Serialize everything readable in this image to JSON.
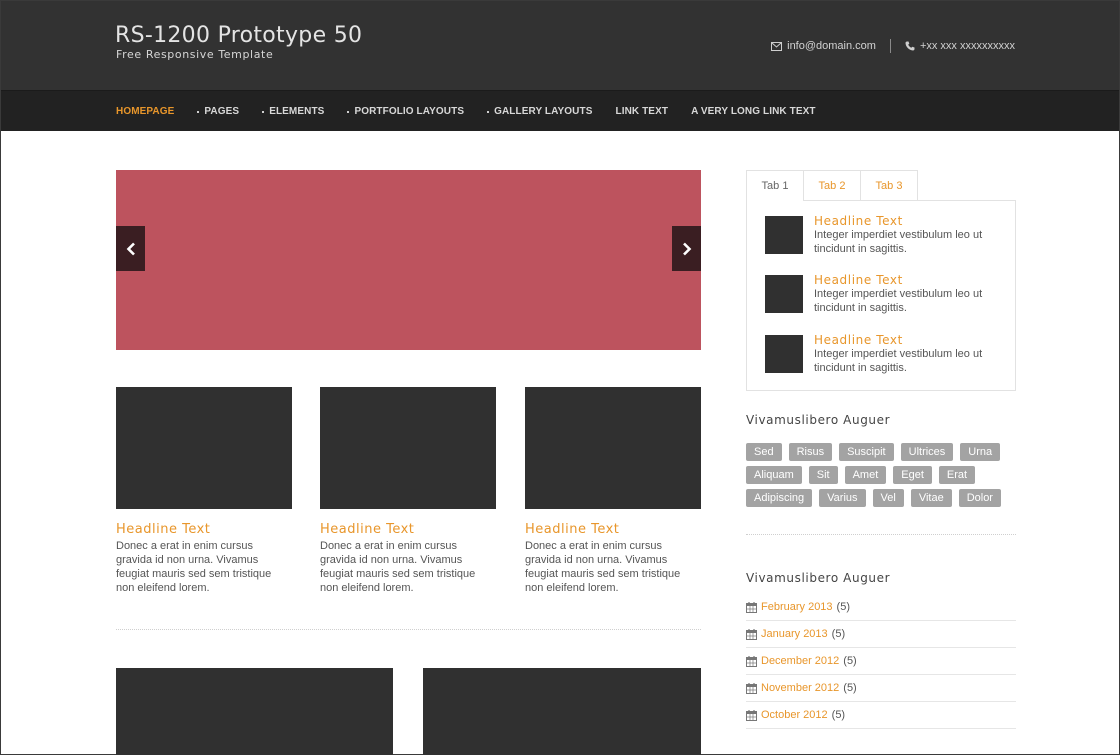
{
  "header": {
    "title": "RS-1200 Prototype 50",
    "tagline": "Free Responsive Template",
    "email": "info@domain.com",
    "phone": "+xx xxx xxxxxxxxxx"
  },
  "nav": {
    "items": [
      {
        "label": "HOMEPAGE"
      },
      {
        "label": "PAGES"
      },
      {
        "label": "ELEMENTS"
      },
      {
        "label": "PORTFOLIO LAYOUTS"
      },
      {
        "label": "GALLERY LAYOUTS"
      },
      {
        "label": "LINK TEXT"
      },
      {
        "label": "A VERY LONG LINK TEXT"
      }
    ]
  },
  "features": [
    {
      "title": "Headline Text",
      "text": "Donec a erat in enim cursus gravida id non urna. Vivamus feugiat mauris sed sem tristique non eleifend lorem."
    },
    {
      "title": "Headline Text",
      "text": "Donec a erat in enim cursus gravida id non urna. Vivamus feugiat mauris sed sem tristique non eleifend lorem."
    },
    {
      "title": "Headline Text",
      "text": "Donec a erat in enim cursus gravida id non urna. Vivamus feugiat mauris sed sem tristique non eleifend lorem."
    }
  ],
  "tabs": {
    "labels": [
      "Tab 1",
      "Tab 2",
      "Tab 3"
    ],
    "items": [
      {
        "title": "Headline Text",
        "text": "Integer imperdiet vestibulum leo ut tincidunt in sagittis."
      },
      {
        "title": "Headline Text",
        "text": "Integer imperdiet vestibulum leo ut tincidunt in sagittis."
      },
      {
        "title": "Headline Text",
        "text": "Integer imperdiet vestibulum leo ut tincidunt in sagittis."
      }
    ]
  },
  "tags_widget": {
    "title": "Vivamuslibero Auguer",
    "tags": [
      "Sed",
      "Risus",
      "Suscipit",
      "Ultrices",
      "Urna",
      "Aliquam",
      "Sit",
      "Amet",
      "Eget",
      "Erat",
      "Adipiscing",
      "Varius",
      "Vel",
      "Vitae",
      "Dolor"
    ]
  },
  "archive_widget": {
    "title": "Vivamuslibero Auguer",
    "items": [
      {
        "label": "February 2013",
        "count": "(5)"
      },
      {
        "label": "January 2013",
        "count": "(5)"
      },
      {
        "label": "December 2012",
        "count": "(5)"
      },
      {
        "label": "November 2012",
        "count": "(5)"
      },
      {
        "label": "October 2012",
        "count": "(5)"
      }
    ]
  },
  "colors": {
    "accent": "#e8962b",
    "header_bg": "#323232",
    "nav_bg": "#222222",
    "slider_bg": "#bd535e",
    "thumb_bg": "#303030",
    "tag_bg": "#a3a3a3"
  }
}
